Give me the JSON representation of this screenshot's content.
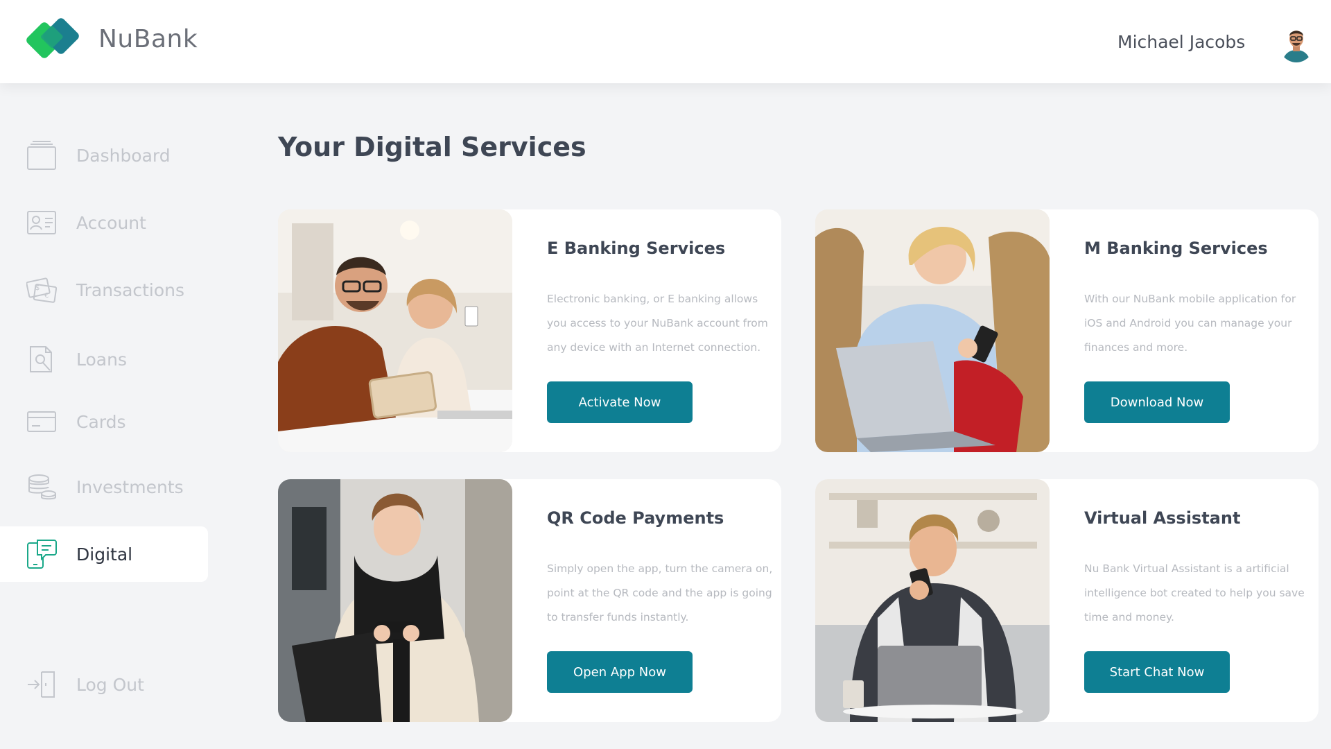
{
  "header": {
    "brand": "NuBank",
    "user_name": "Michael Jacobs"
  },
  "colors": {
    "accent": "#0e7f93",
    "logo_green": "#22c55e",
    "logo_teal": "#1b7f8f",
    "nav_inactive": "#c3c6cc",
    "nav_icon_active": "#1aa889"
  },
  "sidebar": {
    "items": [
      {
        "label": "Dashboard",
        "icon": "dashboard-icon",
        "active": false
      },
      {
        "label": "Account",
        "icon": "account-icon",
        "active": false
      },
      {
        "label": "Transactions",
        "icon": "transactions-icon",
        "active": false
      },
      {
        "label": "Loans",
        "icon": "loans-icon",
        "active": false
      },
      {
        "label": "Cards",
        "icon": "cards-icon",
        "active": false
      },
      {
        "label": "Investments",
        "icon": "investments-icon",
        "active": false
      },
      {
        "label": "Digital",
        "icon": "digital-icon",
        "active": true
      }
    ],
    "logout": {
      "label": "Log Out",
      "icon": "logout-icon"
    }
  },
  "main": {
    "title": "Your Digital Services",
    "cards": [
      {
        "title": "E Banking Services",
        "desc": "Electronic banking, or E banking allows you access to your NuBank account from any device with an Internet connection.",
        "button": "Activate Now"
      },
      {
        "title": "M Banking Services",
        "desc": "With our NuBank mobile application for iOS and Android you can manage your finances and more.",
        "button": "Download Now"
      },
      {
        "title": "QR Code Payments",
        "desc": "Simply open the app, turn the camera on, point at the QR code and the app is going to transfer funds instantly.",
        "button": "Open App Now"
      },
      {
        "title": "Virtual Assistant",
        "desc": "Nu Bank Virtual Assistant is a artificial intelligence bot created to help you save time and money.",
        "button": "Start Chat Now"
      }
    ]
  }
}
